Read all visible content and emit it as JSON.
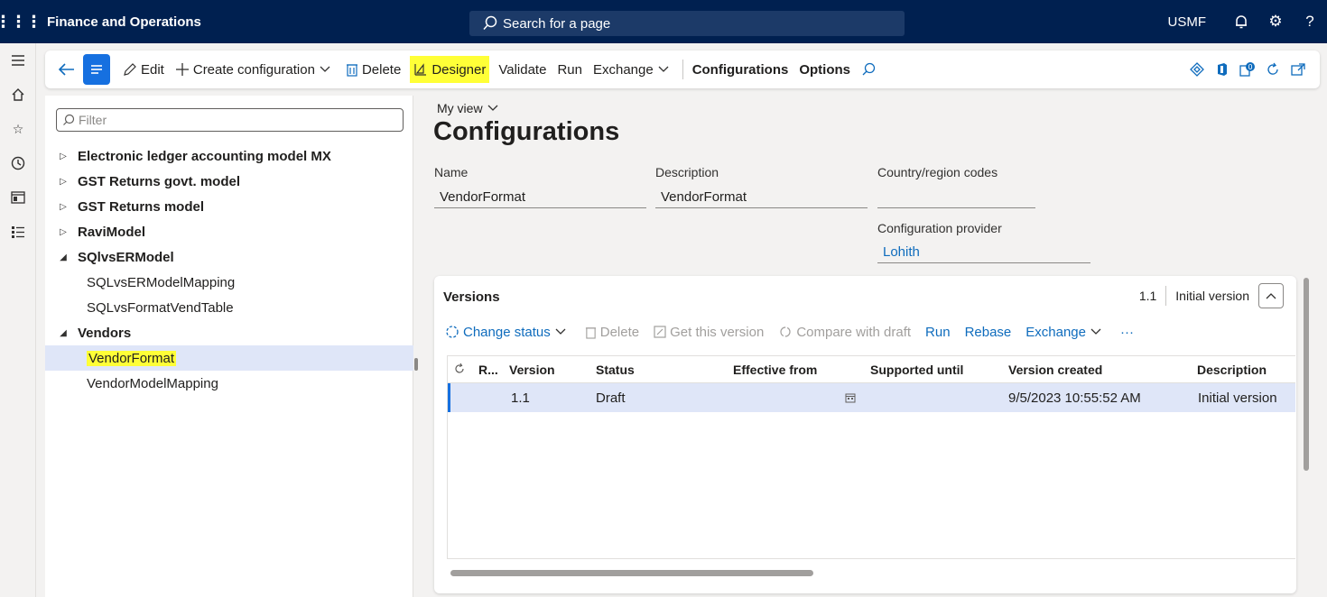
{
  "topbar": {
    "app_title": "Finance and Operations",
    "search_text": "Search for a page",
    "company": "USMF"
  },
  "actions": {
    "edit": "Edit",
    "create_configuration": "Create configuration",
    "delete": "Delete",
    "designer": "Designer",
    "validate": "Validate",
    "run": "Run",
    "exchange": "Exchange",
    "configurations": "Configurations",
    "options": "Options"
  },
  "tree": {
    "filter_placeholder": "Filter",
    "items": [
      {
        "label": "Electronic ledger accounting model MX"
      },
      {
        "label": "GST Returns govt. model"
      },
      {
        "label": "GST Returns model"
      },
      {
        "label": "RaviModel"
      },
      {
        "label": "SQlvsERModel"
      },
      {
        "label": "SQLvsERModelMapping"
      },
      {
        "label": "SQLvsFormatVendTable"
      },
      {
        "label": "Vendors"
      },
      {
        "label": "VendorFormat"
      },
      {
        "label": "VendorModelMapping"
      }
    ]
  },
  "details": {
    "view_label": "My view",
    "page_title": "Configurations",
    "name_label": "Name",
    "name_value": "VendorFormat",
    "description_label": "Description",
    "description_value": "VendorFormat",
    "country_label": "Country/region codes",
    "country_value": "",
    "provider_label": "Configuration provider",
    "provider_value": "Lohith"
  },
  "versions": {
    "title": "Versions",
    "summary_version": "1.1",
    "summary_description": "Initial version",
    "toolbar": {
      "change_status": "Change status",
      "delete": "Delete",
      "get_version": "Get this version",
      "compare": "Compare with draft",
      "run": "Run",
      "rebase": "Rebase",
      "exchange": "Exchange",
      "more": "···"
    },
    "columns": {
      "r": "R...",
      "version": "Version",
      "status": "Status",
      "effective_from": "Effective from",
      "supported_until": "Supported until",
      "version_created": "Version created",
      "description": "Description"
    },
    "rows": [
      {
        "version": "1.1",
        "status": "Draft",
        "effective_from": "",
        "supported_until": "",
        "version_created": "9/5/2023 10:55:52 AM",
        "description": "Initial version"
      }
    ]
  },
  "colors": {
    "topbar": "#002050",
    "accent": "#1670e0",
    "highlight": "#ffff37",
    "selected_row": "#dfe6f8"
  }
}
